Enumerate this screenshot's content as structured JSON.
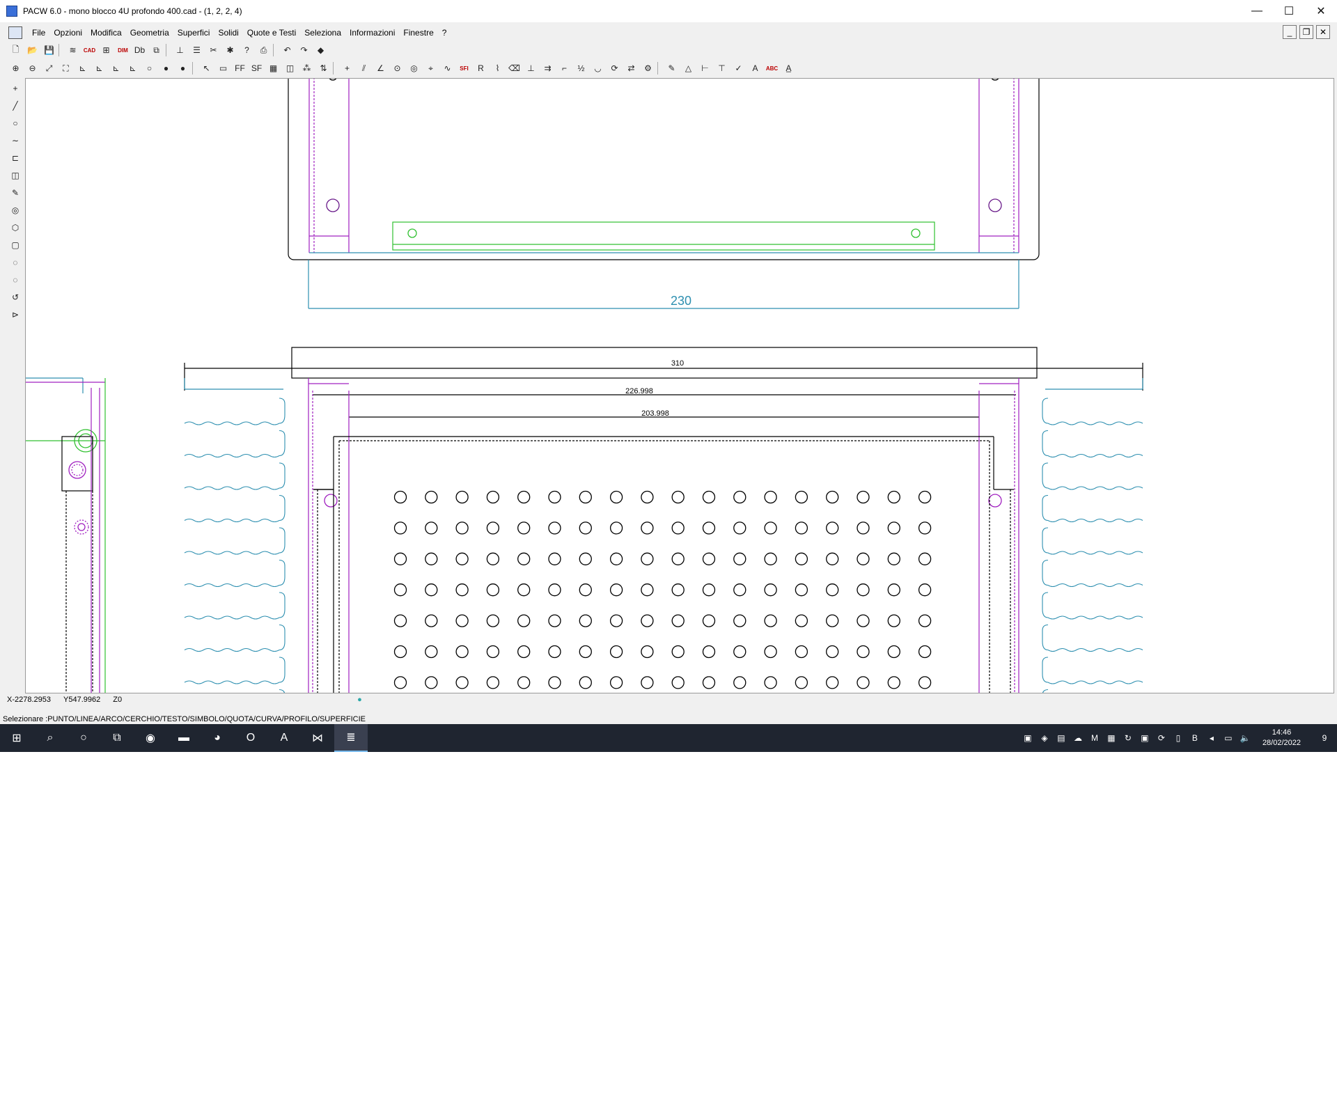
{
  "window": {
    "title": "PACW 6.0 - mono blocco 4U profondo 400.cad - (1, 2, 2, 4)",
    "controls": {
      "minimize": "—",
      "maximize": "☐",
      "close": "✕"
    }
  },
  "menu": {
    "items": [
      "File",
      "Opzioni",
      "Modifica",
      "Geometria",
      "Superfici",
      "Solidi",
      "Quote e Testi",
      "Seleziona",
      "Informazioni",
      "Finestre",
      "?"
    ],
    "mdi_controls": {
      "minimize": "_",
      "restore": "❐",
      "close": "✕"
    }
  },
  "toolbar1": {
    "buttons": [
      {
        "name": "new-icon",
        "glyph": "🗋"
      },
      {
        "name": "open-icon",
        "glyph": "📂"
      },
      {
        "name": "save-icon",
        "glyph": "💾"
      },
      {
        "name": "layers-icon",
        "glyph": "≋"
      },
      {
        "name": "cad-icon",
        "glyph": "CAD"
      },
      {
        "name": "measure-icon",
        "glyph": "⊞"
      },
      {
        "name": "dim-icon",
        "glyph": "DIM"
      },
      {
        "name": "db-icon",
        "glyph": "Db"
      },
      {
        "name": "copy-icon",
        "glyph": "⧉"
      },
      {
        "name": "axis-icon",
        "glyph": "⊥"
      },
      {
        "name": "list-icon",
        "glyph": "☰"
      },
      {
        "name": "cut-icon",
        "glyph": "✂"
      },
      {
        "name": "explode-icon",
        "glyph": "✱"
      },
      {
        "name": "help-icon",
        "glyph": "?"
      },
      {
        "name": "print-icon",
        "glyph": "⎙"
      },
      {
        "name": "undo-icon",
        "glyph": "↶"
      },
      {
        "name": "redo-icon",
        "glyph": "↷"
      },
      {
        "name": "book-icon",
        "glyph": "◆"
      }
    ]
  },
  "toolbar2": {
    "buttons": [
      {
        "name": "zoom-in-icon",
        "glyph": "⊕"
      },
      {
        "name": "zoom-out-icon",
        "glyph": "⊖"
      },
      {
        "name": "zoom-window-icon",
        "glyph": "⤢"
      },
      {
        "name": "zoom-all-icon",
        "glyph": "⛶"
      },
      {
        "name": "view-x-icon",
        "glyph": "⊾"
      },
      {
        "name": "view-y-icon",
        "glyph": "⊾"
      },
      {
        "name": "view-z-icon",
        "glyph": "⊾"
      },
      {
        "name": "view-iso-icon",
        "glyph": "⊾"
      },
      {
        "name": "wire-icon",
        "glyph": "○"
      },
      {
        "name": "shade-icon",
        "glyph": "●"
      },
      {
        "name": "render-icon",
        "glyph": "●"
      },
      {
        "name": "select-icon",
        "glyph": "↖"
      },
      {
        "name": "rect-select-icon",
        "glyph": "▭"
      },
      {
        "name": "ff-icon",
        "glyph": "FF"
      },
      {
        "name": "sf-icon",
        "glyph": "SF"
      },
      {
        "name": "cube-icon",
        "glyph": "▦"
      },
      {
        "name": "box-icon",
        "glyph": "◫"
      },
      {
        "name": "set-icon",
        "glyph": "⁂"
      },
      {
        "name": "sort-icon",
        "glyph": "⇅"
      },
      {
        "name": "cross-icon",
        "glyph": "+"
      },
      {
        "name": "parallel-icon",
        "glyph": "⫽"
      },
      {
        "name": "angle-icon",
        "glyph": "∠"
      },
      {
        "name": "circle-center-icon",
        "glyph": "⊙"
      },
      {
        "name": "circle-tan-icon",
        "glyph": "◎"
      },
      {
        "name": "snap-icon",
        "glyph": "⌖"
      },
      {
        "name": "curve-icon",
        "glyph": "∿"
      },
      {
        "name": "sfi-icon",
        "glyph": "SFI"
      },
      {
        "name": "radius-icon",
        "glyph": "R"
      },
      {
        "name": "trim-icon",
        "glyph": "⌇"
      },
      {
        "name": "erase-icon",
        "glyph": "⌫"
      },
      {
        "name": "align-icon",
        "glyph": "⊥"
      },
      {
        "name": "offset-icon",
        "glyph": "⇉"
      },
      {
        "name": "chamfer-icon",
        "glyph": "⌐"
      },
      {
        "name": "half-icon",
        "glyph": "½"
      },
      {
        "name": "arc-icon",
        "glyph": "◡"
      },
      {
        "name": "rotate-icon",
        "glyph": "⟳"
      },
      {
        "name": "mirror-icon",
        "glyph": "⇄"
      },
      {
        "name": "tools-icon",
        "glyph": "⚙"
      },
      {
        "name": "pen-icon",
        "glyph": "✎"
      },
      {
        "name": "triangle-icon",
        "glyph": "△"
      },
      {
        "name": "dim-h-icon",
        "glyph": "⊢"
      },
      {
        "name": "dim-v-icon",
        "glyph": "⊤"
      },
      {
        "name": "check-icon",
        "glyph": "✓"
      },
      {
        "name": "text-icon",
        "glyph": "A"
      },
      {
        "name": "abc-icon",
        "glyph": "ABC"
      },
      {
        "name": "edit-text-icon",
        "glyph": "A̲"
      }
    ]
  },
  "vtoolbar": {
    "buttons": [
      {
        "name": "point-tool-icon",
        "glyph": "+"
      },
      {
        "name": "line-tool-icon",
        "glyph": "╱"
      },
      {
        "name": "circle-tool-icon",
        "glyph": "○"
      },
      {
        "name": "spline-tool-icon",
        "glyph": "∼"
      },
      {
        "name": "profile-tool-icon",
        "glyph": "⊏"
      },
      {
        "name": "surface-tool-icon",
        "glyph": "◫"
      },
      {
        "name": "pencil-tool-icon",
        "glyph": "✎"
      },
      {
        "name": "symbol-tool-icon",
        "glyph": "◎"
      },
      {
        "name": "solid-tool-icon",
        "glyph": "⬡"
      },
      {
        "name": "frame-tool-icon",
        "glyph": "▢"
      },
      {
        "name": "red-tool-icon",
        "glyph": "◌"
      },
      {
        "name": "grey-tool-1-icon",
        "glyph": "◌"
      },
      {
        "name": "grey-tool-2-icon",
        "glyph": "↺"
      },
      {
        "name": "filter-select-icon",
        "glyph": "⊳"
      }
    ]
  },
  "drawing": {
    "dimensions": {
      "top": "230",
      "outer": "310",
      "inner1": "226.998",
      "inner2": "203.998"
    },
    "colors": {
      "magenta": "#a020c0",
      "green": "#30c030",
      "cyan": "#2d8fb0",
      "black": "#000000",
      "teal": "#2aa8a8"
    }
  },
  "status": {
    "x": "X-2278.2953",
    "y": "Y547.9962",
    "z": "Z0"
  },
  "command_line": "Selezionare :PUNTO/LINEA/ARCO/CERCHIO/TESTO/SIMBOLO/QUOTA/CURVA/PROFILO/SUPERFICIE",
  "taskbar": {
    "apps": [
      {
        "name": "start-icon",
        "glyph": "⊞"
      },
      {
        "name": "search-icon",
        "glyph": "⌕"
      },
      {
        "name": "cortana-icon",
        "glyph": "○"
      },
      {
        "name": "taskview-icon",
        "glyph": "⧉"
      },
      {
        "name": "edge-icon",
        "glyph": "◉"
      },
      {
        "name": "explorer-icon",
        "glyph": "▬"
      },
      {
        "name": "firefox-icon",
        "glyph": "◕"
      },
      {
        "name": "outlook-icon",
        "glyph": "O"
      },
      {
        "name": "autocad-icon",
        "glyph": "A"
      },
      {
        "name": "app-green-icon",
        "glyph": "⋈"
      },
      {
        "name": "pacw-icon",
        "glyph": "≣"
      }
    ],
    "tray_icons": [
      "▣",
      "◈",
      "▤",
      "☁",
      "M",
      "▦",
      "↻",
      "▣",
      "⟳",
      "▯",
      "B",
      "◂",
      "▭",
      "🔈"
    ],
    "time": "14:46",
    "date": "28/02/2022",
    "notification_count": "9"
  }
}
